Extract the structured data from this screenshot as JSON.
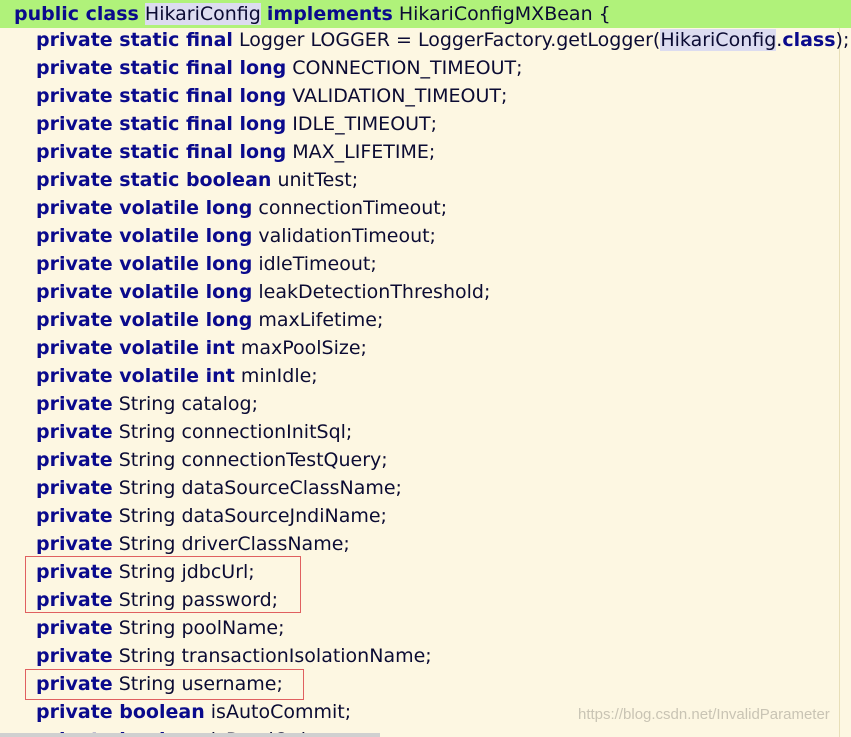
{
  "header": {
    "kw": "public class",
    "cls": "HikariConfig",
    "kw2": "implements",
    "iface": "HikariConfigMXBean {"
  },
  "logger": {
    "kw": "private static final",
    "mid": " Logger LOGGER = LoggerFactory.getLogger(",
    "cls": "HikariConfig",
    "dot": ".",
    "classkw": "class",
    "end": ");"
  },
  "lines": [
    {
      "kw": "private static final long",
      "rest": " CONNECTION_TIMEOUT;"
    },
    {
      "kw": "private static final long",
      "rest": " VALIDATION_TIMEOUT;"
    },
    {
      "kw": "private static final long",
      "rest": " IDLE_TIMEOUT;"
    },
    {
      "kw": "private static final long",
      "rest": " MAX_LIFETIME;"
    },
    {
      "kw": "private static boolean",
      "rest": " unitTest;"
    },
    {
      "kw": "private volatile long",
      "rest": " connectionTimeout;"
    },
    {
      "kw": "private volatile long",
      "rest": " validationTimeout;"
    },
    {
      "kw": "private volatile long",
      "rest": " idleTimeout;"
    },
    {
      "kw": "private volatile long",
      "rest": " leakDetectionThreshold;"
    },
    {
      "kw": "private volatile long",
      "rest": " maxLifetime;"
    },
    {
      "kw": "private volatile int",
      "rest": " maxPoolSize;"
    },
    {
      "kw": "private volatile int",
      "rest": " minIdle;"
    },
    {
      "kw": "private",
      "rest": " String catalog;"
    },
    {
      "kw": "private",
      "rest": " String connectionInitSql;"
    },
    {
      "kw": "private",
      "rest": " String connectionTestQuery;"
    },
    {
      "kw": "private",
      "rest": " String dataSourceClassName;"
    },
    {
      "kw": "private",
      "rest": " String dataSourceJndiName;"
    },
    {
      "kw": "private",
      "rest": " String driverClassName;"
    },
    {
      "kw": "private",
      "rest": " String jdbcUrl;"
    },
    {
      "kw": "private",
      "rest": " String password;"
    },
    {
      "kw": "private",
      "rest": " String poolName;"
    },
    {
      "kw": "private",
      "rest": " String transactionIsolationName;"
    },
    {
      "kw": "private",
      "rest": " String username;"
    },
    {
      "kw": "private boolean",
      "rest": " isAutoCommit;"
    },
    {
      "kw": "private boolean",
      "rest": " isReadOnly;"
    }
  ],
  "watermark": "https://blog.csdn.net/InvalidParameter",
  "colors": {
    "keyword": "#0a0a8c",
    "background": "#fdf7e2",
    "header_highlight": "#b0f27a",
    "annotation_box": "#e06060"
  }
}
